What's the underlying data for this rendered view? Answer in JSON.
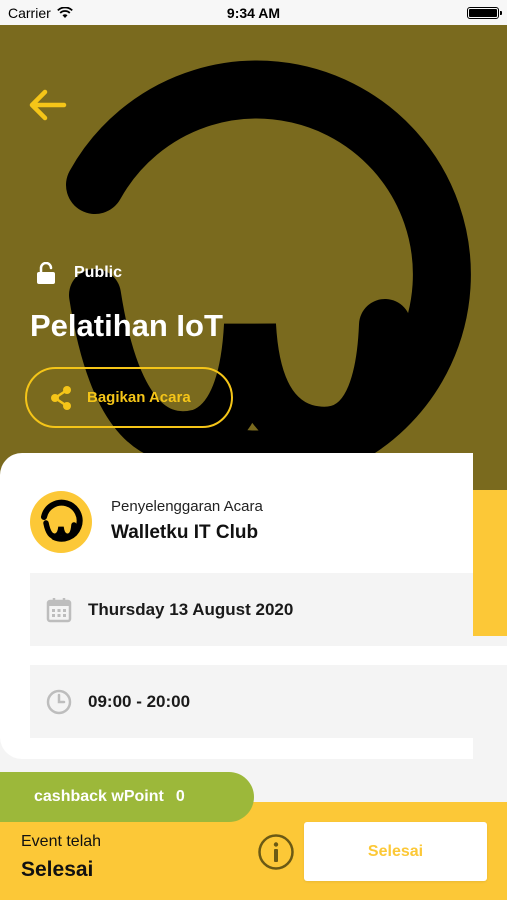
{
  "status_bar": {
    "carrier": "Carrier",
    "time": "9:34 AM"
  },
  "event": {
    "privacy": "Public",
    "title": "Pelatihan IoT",
    "share_label": "Bagikan Acara"
  },
  "organizer": {
    "label": "Penyelenggaran Acara",
    "name": "Walletku IT Club"
  },
  "details": {
    "date": "Thursday 13 August 2020",
    "time": "09:00 - 20:00"
  },
  "cashback": {
    "label": "cashback wPoint",
    "value": "0"
  },
  "footer": {
    "event_label": "Event telah",
    "event_status": "Selesai",
    "done_button": "Selesai"
  },
  "colors": {
    "accent": "#fcc837",
    "hero_bg": "#7a6a1e",
    "cashback": "#9cb83a"
  },
  "icons": [
    "wifi-icon",
    "battery-icon",
    "back-arrow-icon",
    "unlock-icon",
    "share-icon",
    "calendar-icon",
    "clock-icon",
    "info-icon"
  ]
}
